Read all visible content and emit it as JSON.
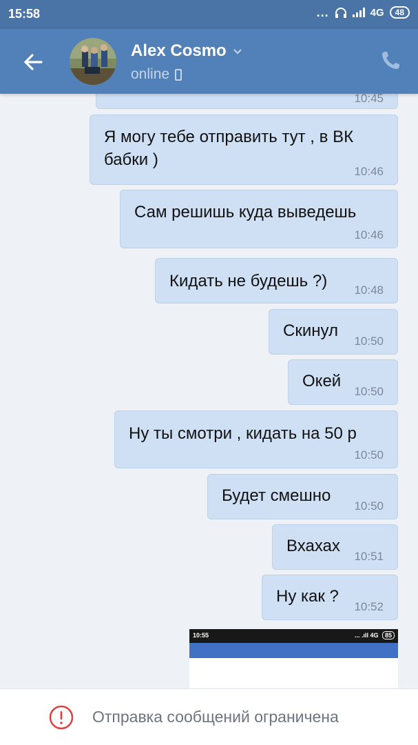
{
  "status_bar": {
    "time": "15:58",
    "dots": "...",
    "network": "4G",
    "battery": "48"
  },
  "header": {
    "contact_name": "Alex Cosmo",
    "status": "online",
    "back_icon": "arrow-left-icon",
    "chevron_icon": "chevron-down-icon",
    "call_icon": "phone-icon"
  },
  "messages": [
    {
      "text": "",
      "time": "10:45"
    },
    {
      "text": "Я могу тебе  отправить тут , в ВК\nбабки )",
      "time": "10:46"
    },
    {
      "text": "Сам решишь куда выведешь",
      "time": "10:46"
    },
    {
      "text": "Кидать не будешь ?)",
      "time": "10:48"
    },
    {
      "text": "Скинул",
      "time": "10:50"
    },
    {
      "text": "Окей",
      "time": "10:50"
    },
    {
      "text": "Ну ты смотри , кидать на 50 р",
      "time": "10:50"
    },
    {
      "text": "Будет смешно",
      "time": "10:50"
    },
    {
      "text": "Вхахах",
      "time": "10:51"
    },
    {
      "text": "Ну как ?",
      "time": "10:52"
    }
  ],
  "attachment": {
    "mini_time": "10:55",
    "mini_network": "4G",
    "mini_battery": "85"
  },
  "bottom_bar": {
    "warning_icon": "exclamation-circle-icon",
    "text": "Отправка сообщений ограничена"
  },
  "colors": {
    "status_bar": "#4a74a6",
    "header": "#5181b8",
    "bubble": "#cfe0f5",
    "background": "#eef1f5"
  }
}
